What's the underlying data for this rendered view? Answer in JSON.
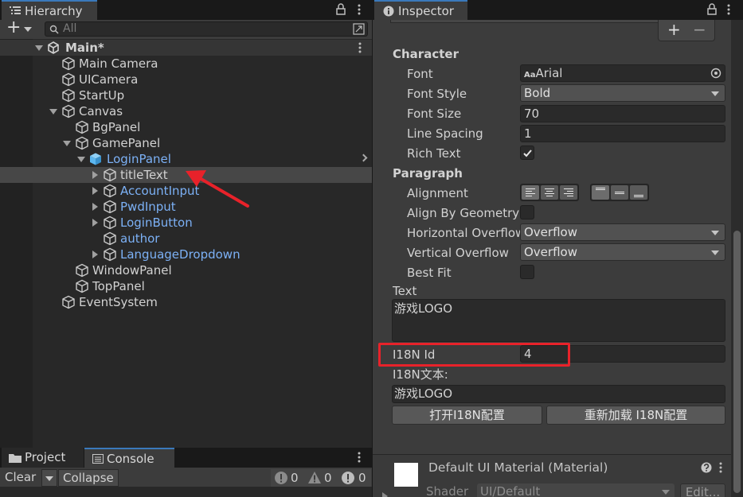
{
  "hierarchy": {
    "tab_label": "Hierarchy",
    "add_button": "+",
    "search_placeholder": "All",
    "scene_name": "Main*",
    "items": [
      {
        "label": "Main Camera"
      },
      {
        "label": "UICamera"
      },
      {
        "label": "StartUp"
      },
      {
        "label": "Canvas"
      },
      {
        "label": "BgPanel"
      },
      {
        "label": "GamePanel"
      },
      {
        "label": "LoginPanel"
      },
      {
        "label": "titleText"
      },
      {
        "label": "AccountInput"
      },
      {
        "label": "PwdInput"
      },
      {
        "label": "LoginButton"
      },
      {
        "label": "author"
      },
      {
        "label": "LanguageDropdown"
      },
      {
        "label": "WindowPanel"
      },
      {
        "label": "TopPanel"
      },
      {
        "label": "EventSystem"
      }
    ]
  },
  "bottom": {
    "tabs": [
      {
        "label": "Project"
      },
      {
        "label": "Console"
      }
    ],
    "clear_label": "Clear",
    "collapse_label": "Collapse",
    "counts": {
      "info": "0",
      "warning": "0",
      "error": "0"
    }
  },
  "inspector": {
    "tab_label": "Inspector",
    "plus": "+",
    "minus": "−",
    "character_header": "Character",
    "font_label": "Font",
    "font_prefix": "Aa",
    "font_value": "Arial",
    "font_style_label": "Font Style",
    "font_style_value": "Bold",
    "font_size_label": "Font Size",
    "font_size_value": "70",
    "line_spacing_label": "Line Spacing",
    "line_spacing_value": "1",
    "rich_text_label": "Rich Text",
    "rich_text_checked": true,
    "paragraph_header": "Paragraph",
    "alignment_label": "Alignment",
    "align_by_geometry_label": "Align By Geometry",
    "horizontal_overflow_label": "Horizontal Overflow",
    "horizontal_overflow_value": "Overflow",
    "vertical_overflow_label": "Vertical Overflow",
    "vertical_overflow_value": "Overflow",
    "best_fit_label": "Best Fit",
    "text_label": "Text",
    "text_value": "游戏LOGO",
    "i18n_id_label": "I18N Id",
    "i18n_id_value": "4",
    "i18n_text_label": "I18N文本:",
    "i18n_text_value": "游戏LOGO",
    "open_config_button": "打开I18N配置",
    "reload_config_button": "重新加载 I18N配置",
    "material_title": "Default UI Material (Material)",
    "shader_label": "Shader",
    "shader_value": "UI/Default",
    "edit_button": "Edit..."
  },
  "colors": {
    "accent": "#3a79bb",
    "annotation": "#e8222a",
    "link_blue": "#7cb1f6",
    "prefab_cube": "#5cb7f0"
  }
}
